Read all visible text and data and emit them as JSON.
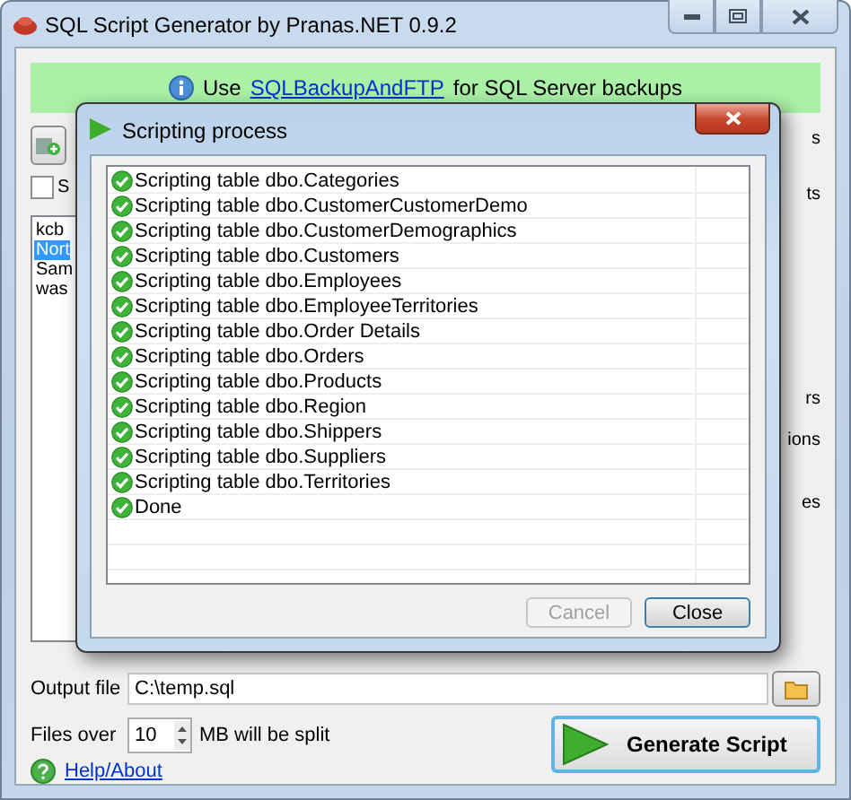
{
  "window": {
    "title": "SQL Script Generator by Pranas.NET 0.9.2"
  },
  "banner": {
    "prefix": "Use",
    "link": "SQLBackupAndFTP",
    "suffix": "for SQL Server backups"
  },
  "main": {
    "checkbox": {
      "label": "S",
      "checked": false
    },
    "databases": [
      {
        "label": "kcb",
        "selected": false
      },
      {
        "label": "Nort",
        "selected": true
      },
      {
        "label": "Sam",
        "selected": false
      },
      {
        "label": "was",
        "selected": false
      }
    ],
    "right_labels": [
      "s",
      "ts",
      "rs",
      "ions",
      "es"
    ]
  },
  "dialog": {
    "title": "Scripting process",
    "items": [
      "Scripting table dbo.Categories",
      "Scripting table dbo.CustomerCustomerDemo",
      "Scripting table dbo.CustomerDemographics",
      "Scripting table dbo.Customers",
      "Scripting table dbo.Employees",
      "Scripting table dbo.EmployeeTerritories",
      "Scripting table dbo.Order Details",
      "Scripting table dbo.Orders",
      "Scripting table dbo.Products",
      "Scripting table dbo.Region",
      "Scripting table dbo.Shippers",
      "Scripting table dbo.Suppliers",
      "Scripting table dbo.Territories",
      "Done"
    ],
    "buttons": [
      {
        "label": "Cancel",
        "disabled": true
      },
      {
        "label": "Close",
        "disabled": false
      }
    ]
  },
  "output": {
    "label": "Output file",
    "value": "C:\\temp.sql"
  },
  "split": {
    "label": "Files over",
    "value": "10",
    "suffix": "MB will be split"
  },
  "help": "Help/About",
  "generate": "Generate Script"
}
